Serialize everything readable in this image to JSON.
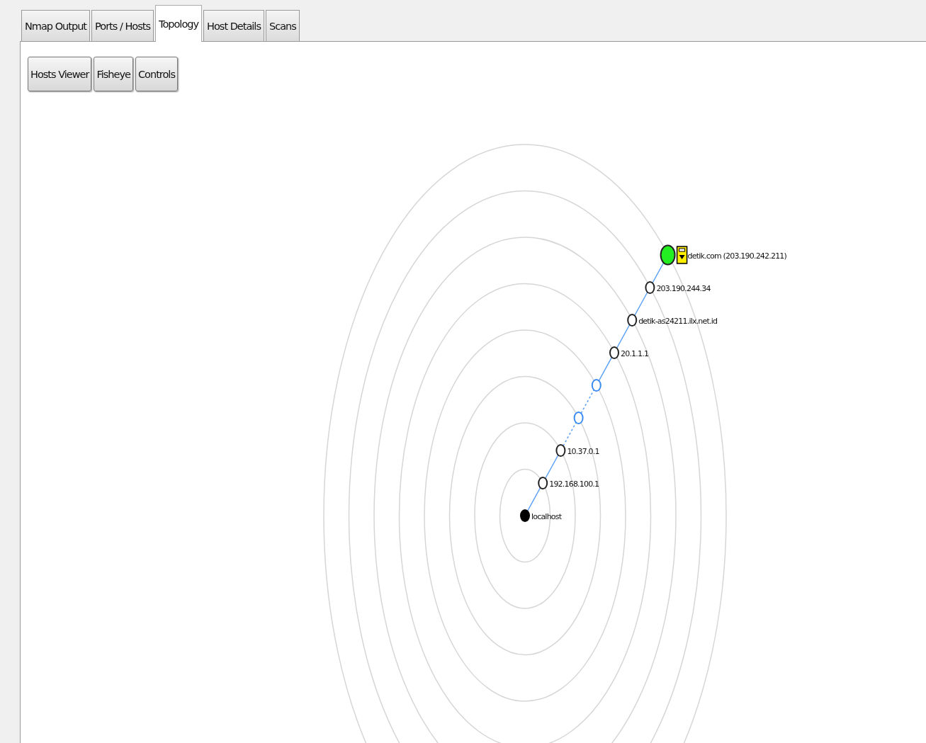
{
  "tabs": [
    {
      "label": "Nmap Output",
      "selected": false
    },
    {
      "label": "Ports / Hosts",
      "selected": false
    },
    {
      "label": "Topology",
      "selected": true
    },
    {
      "label": "Host Details",
      "selected": false
    },
    {
      "label": "Scans",
      "selected": false
    }
  ],
  "toolbar": [
    "Hosts Viewer",
    "Fisheye",
    "Controls"
  ],
  "topology": {
    "nodes": [
      {
        "label": "detik.com (203.190.242.211)",
        "kind": "target",
        "dashed_link": false
      },
      {
        "label": "203.190.244.34",
        "kind": "router",
        "dashed_link": false
      },
      {
        "label": "detik-as24211.ilx.net.id",
        "kind": "router",
        "dashed_link": false
      },
      {
        "label": "20.1.1.1",
        "kind": "router",
        "dashed_link": false
      },
      {
        "kind": "unknown",
        "dashed_link": true
      },
      {
        "kind": "unknown",
        "dashed_link": true
      },
      {
        "label": "10.37.0.1",
        "kind": "router",
        "dashed_link": false
      },
      {
        "label": "192.168.100.1",
        "kind": "router",
        "dashed_link": false
      },
      {
        "label": "localhost",
        "kind": "local"
      }
    ]
  }
}
